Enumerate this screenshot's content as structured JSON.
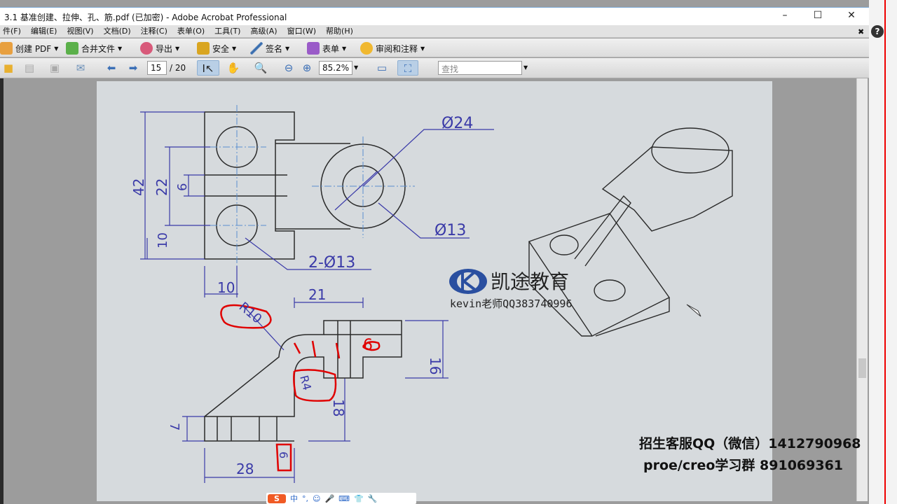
{
  "window": {
    "title": "3.1  基准创建、拉伸、孔、筋.pdf  (已加密)  - Adobe Acrobat Professional",
    "minimize": "–",
    "maximize": "☐",
    "close": "✕"
  },
  "menu": [
    "件(F)",
    "编辑(E)",
    "视图(V)",
    "文档(D)",
    "注释(C)",
    "表单(O)",
    "工具(T)",
    "高级(A)",
    "窗口(W)",
    "帮助(H)"
  ],
  "menu_close": "✖",
  "toolbar1": [
    {
      "label": "创建 PDF",
      "icon": "create-pdf-icon"
    },
    {
      "label": "合并文件",
      "icon": "combine-files-icon"
    },
    {
      "label": "导出",
      "icon": "export-icon"
    },
    {
      "label": "安全",
      "icon": "lock-icon"
    },
    {
      "label": "签名",
      "icon": "pen-icon"
    },
    {
      "label": "表单",
      "icon": "form-icon"
    },
    {
      "label": "审阅和注释",
      "icon": "comment-icon"
    }
  ],
  "toolbar2": {
    "page_current": "15",
    "page_total": "/ 20",
    "zoom": "85.2%",
    "find_placeholder": "查找"
  },
  "drawing": {
    "d24": "Ø24",
    "d13": "Ø13",
    "holes": "2-Ø13",
    "h42": "42",
    "h22": "22",
    "h6": "6",
    "h10": "10",
    "w10": "10",
    "w21": "21",
    "r10": "R10",
    "n6": "6",
    "r4": "R4",
    "h16": "16",
    "h18": "18",
    "h7": "7",
    "w28": "28",
    "w6": "6"
  },
  "watermark": {
    "logo_text": "凯途教育",
    "teacher": "kevin老师QQ383740996",
    "line1": "招生客服QQ（微信）1412790968",
    "line2": "proe/creo学习群 891069361"
  },
  "ime": {
    "label": "中",
    "items": [
      "°,",
      "☺",
      "🎤",
      "⌨",
      "👕",
      "🔧"
    ]
  },
  "colors": {
    "dim": "#3a3aa8",
    "annot": "#e00000",
    "center": "#5a8fd0"
  }
}
